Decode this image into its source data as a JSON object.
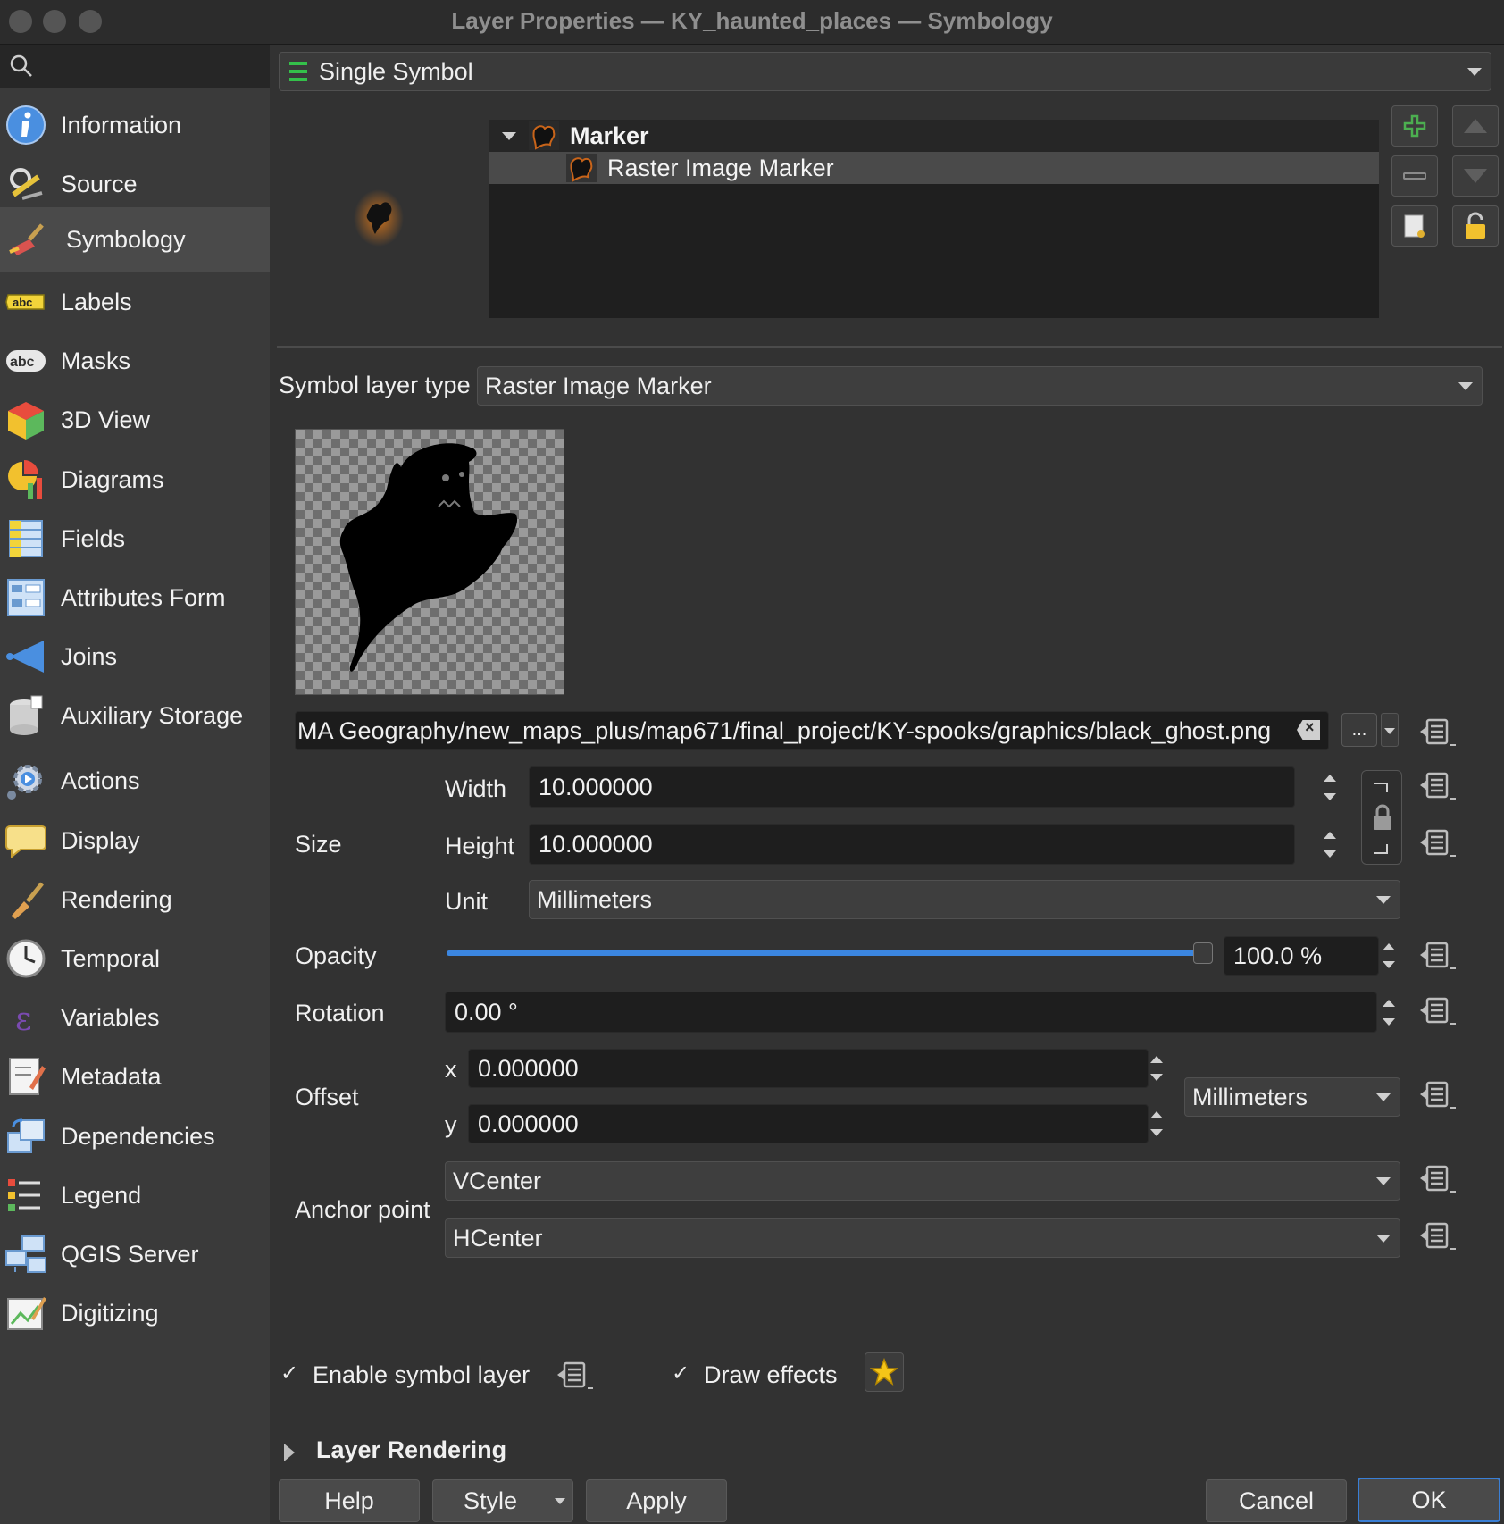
{
  "window": {
    "title": "Layer Properties — KY_haunted_places — Symbology"
  },
  "sidebar": {
    "items": [
      {
        "label": "Information",
        "icon": "info-icon"
      },
      {
        "label": "Source",
        "icon": "source-icon"
      },
      {
        "label": "Symbology",
        "icon": "paintbrush-icon"
      },
      {
        "label": "Labels",
        "icon": "labels-icon"
      },
      {
        "label": "Masks",
        "icon": "masks-icon"
      },
      {
        "label": "3D View",
        "icon": "cube-icon"
      },
      {
        "label": "Diagrams",
        "icon": "diagrams-icon"
      },
      {
        "label": "Fields",
        "icon": "fields-icon"
      },
      {
        "label": "Attributes Form",
        "icon": "form-icon"
      },
      {
        "label": "Joins",
        "icon": "joins-icon"
      },
      {
        "label": "Auxiliary Storage",
        "icon": "database-icon"
      },
      {
        "label": "Actions",
        "icon": "gear-icon"
      },
      {
        "label": "Display",
        "icon": "speech-bubble-icon"
      },
      {
        "label": "Rendering",
        "icon": "brush-icon"
      },
      {
        "label": "Temporal",
        "icon": "clock-icon"
      },
      {
        "label": "Variables",
        "icon": "epsilon-icon"
      },
      {
        "label": "Metadata",
        "icon": "metadata-icon"
      },
      {
        "label": "Dependencies",
        "icon": "dependencies-icon"
      },
      {
        "label": "Legend",
        "icon": "legend-icon"
      },
      {
        "label": "QGIS Server",
        "icon": "server-icon"
      },
      {
        "label": "Digitizing",
        "icon": "digitizing-icon"
      }
    ],
    "selected": "Symbology"
  },
  "renderer": {
    "value": "Single Symbol"
  },
  "symbol_tree": {
    "root": "Marker",
    "child": "Raster Image Marker"
  },
  "symbol_layer_type": {
    "label": "Symbol layer type",
    "value": "Raster Image Marker"
  },
  "file_path": {
    "value": "MA Geography/new_maps_plus/map671/final_project/KY-spooks/graphics/black_ghost.png",
    "browse": "..."
  },
  "size": {
    "label": "Size",
    "width_label": "Width",
    "width": "10.000000",
    "height_label": "Height",
    "height": "10.000000",
    "unit_label": "Unit",
    "unit": "Millimeters"
  },
  "opacity": {
    "label": "Opacity",
    "value": "100.0 %",
    "fraction": 1.0
  },
  "rotation": {
    "label": "Rotation",
    "value": "0.00 °"
  },
  "offset": {
    "label": "Offset",
    "x_label": "x",
    "x": "0.000000",
    "y_label": "y",
    "y": "0.000000",
    "unit": "Millimeters"
  },
  "anchor": {
    "label": "Anchor point",
    "vertical": "VCenter",
    "horizontal": "HCenter"
  },
  "options": {
    "enable_symbol_layer": "Enable symbol layer",
    "draw_effects": "Draw effects"
  },
  "layer_rendering": {
    "label": "Layer Rendering"
  },
  "buttons": {
    "help": "Help",
    "style": "Style",
    "apply": "Apply",
    "cancel": "Cancel",
    "ok": "OK"
  },
  "colors": {
    "accent": "#3b86e0",
    "ok_border": "#3a7fd5",
    "plus_green": "#4caf50",
    "lock_yellow": "#f2c12e"
  }
}
